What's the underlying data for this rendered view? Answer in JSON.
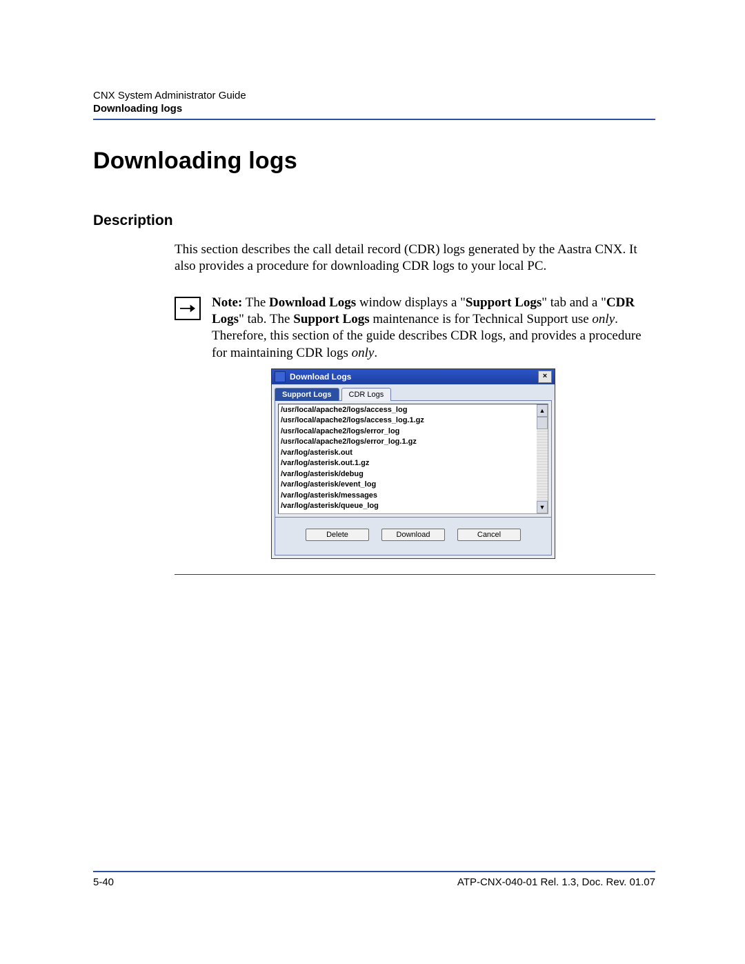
{
  "header": {
    "guide": "CNX System Administrator Guide",
    "section": "Downloading logs"
  },
  "title": "Downloading logs",
  "description_heading": "Description",
  "description_para": "This section describes the call detail record (CDR) logs generated by the Aastra CNX. It also provides a procedure for downloading CDR logs to your local PC.",
  "note": {
    "prefix": "Note:",
    "t1": " The ",
    "b1": "Download Logs",
    "t2": " window displays a \"",
    "b2": "Support Logs",
    "t3": "\" tab and a \"",
    "b3": "CDR Logs",
    "t4": "\" tab. The ",
    "b4": "Support Logs",
    "t5": " maintenance is for Technical Support use ",
    "i1": "only",
    "t6": ". Therefore, this section of the guide describes CDR logs, and provides a procedure for maintaining CDR logs ",
    "i2": "only",
    "t7": "."
  },
  "window": {
    "title": "Download Logs",
    "close": "×",
    "tabs": {
      "active": "Support Logs",
      "inactive": "CDR Logs"
    },
    "items": [
      "/usr/local/apache2/logs/access_log",
      "/usr/local/apache2/logs/access_log.1.gz",
      "/usr/local/apache2/logs/error_log",
      "/usr/local/apache2/logs/error_log.1.gz",
      "/var/log/asterisk.out",
      "/var/log/asterisk.out.1.gz",
      "/var/log/asterisk/debug",
      "/var/log/asterisk/event_log",
      "/var/log/asterisk/messages",
      "/var/log/asterisk/queue_log"
    ],
    "buttons": {
      "delete": "Delete",
      "download": "Download",
      "cancel": "Cancel"
    },
    "scroll": {
      "up": "▲",
      "down": "▼"
    }
  },
  "footer": {
    "left": "5-40",
    "right": "ATP-CNX-040-01 Rel. 1.3, Doc. Rev. 01.07"
  }
}
